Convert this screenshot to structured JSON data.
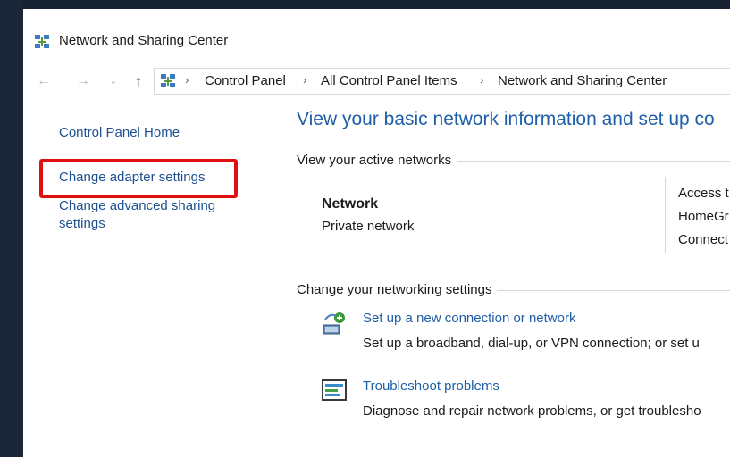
{
  "window": {
    "title": "Network and Sharing Center"
  },
  "nav": {
    "back_icon": "back-arrow-icon",
    "forward_icon": "forward-arrow-icon",
    "up_icon": "up-arrow-icon",
    "breadcrumb": [
      "Control Panel",
      "All Control Panel Items",
      "Network and Sharing Center"
    ]
  },
  "sidebar": {
    "items": [
      {
        "label": "Control Panel Home"
      },
      {
        "label": "Change adapter settings"
      },
      {
        "label": "Change advanced sharing"
      },
      {
        "label": "settings"
      }
    ],
    "highlight_color": "#e01010"
  },
  "main": {
    "heading": "View your basic network information and set up co",
    "active_networks_label": "View your active networks",
    "network": {
      "name": "Network",
      "type": "Private network",
      "access_label": "Access t",
      "homegroup_label": "HomeGr",
      "connections_label": "Connect"
    },
    "change_settings_label": "Change your networking settings",
    "tasks": [
      {
        "icon": "new-connection-icon",
        "link": "Set up a new connection or network",
        "desc": "Set up a broadband, dial-up, or VPN connection; or set u"
      },
      {
        "icon": "troubleshoot-icon",
        "link": "Troubleshoot problems",
        "desc": "Diagnose and repair network problems, or get troublesho"
      }
    ]
  },
  "colors": {
    "link": "#1e5fa8",
    "sidebar_link": "#1d4f91",
    "text": "#1a1a1a"
  }
}
